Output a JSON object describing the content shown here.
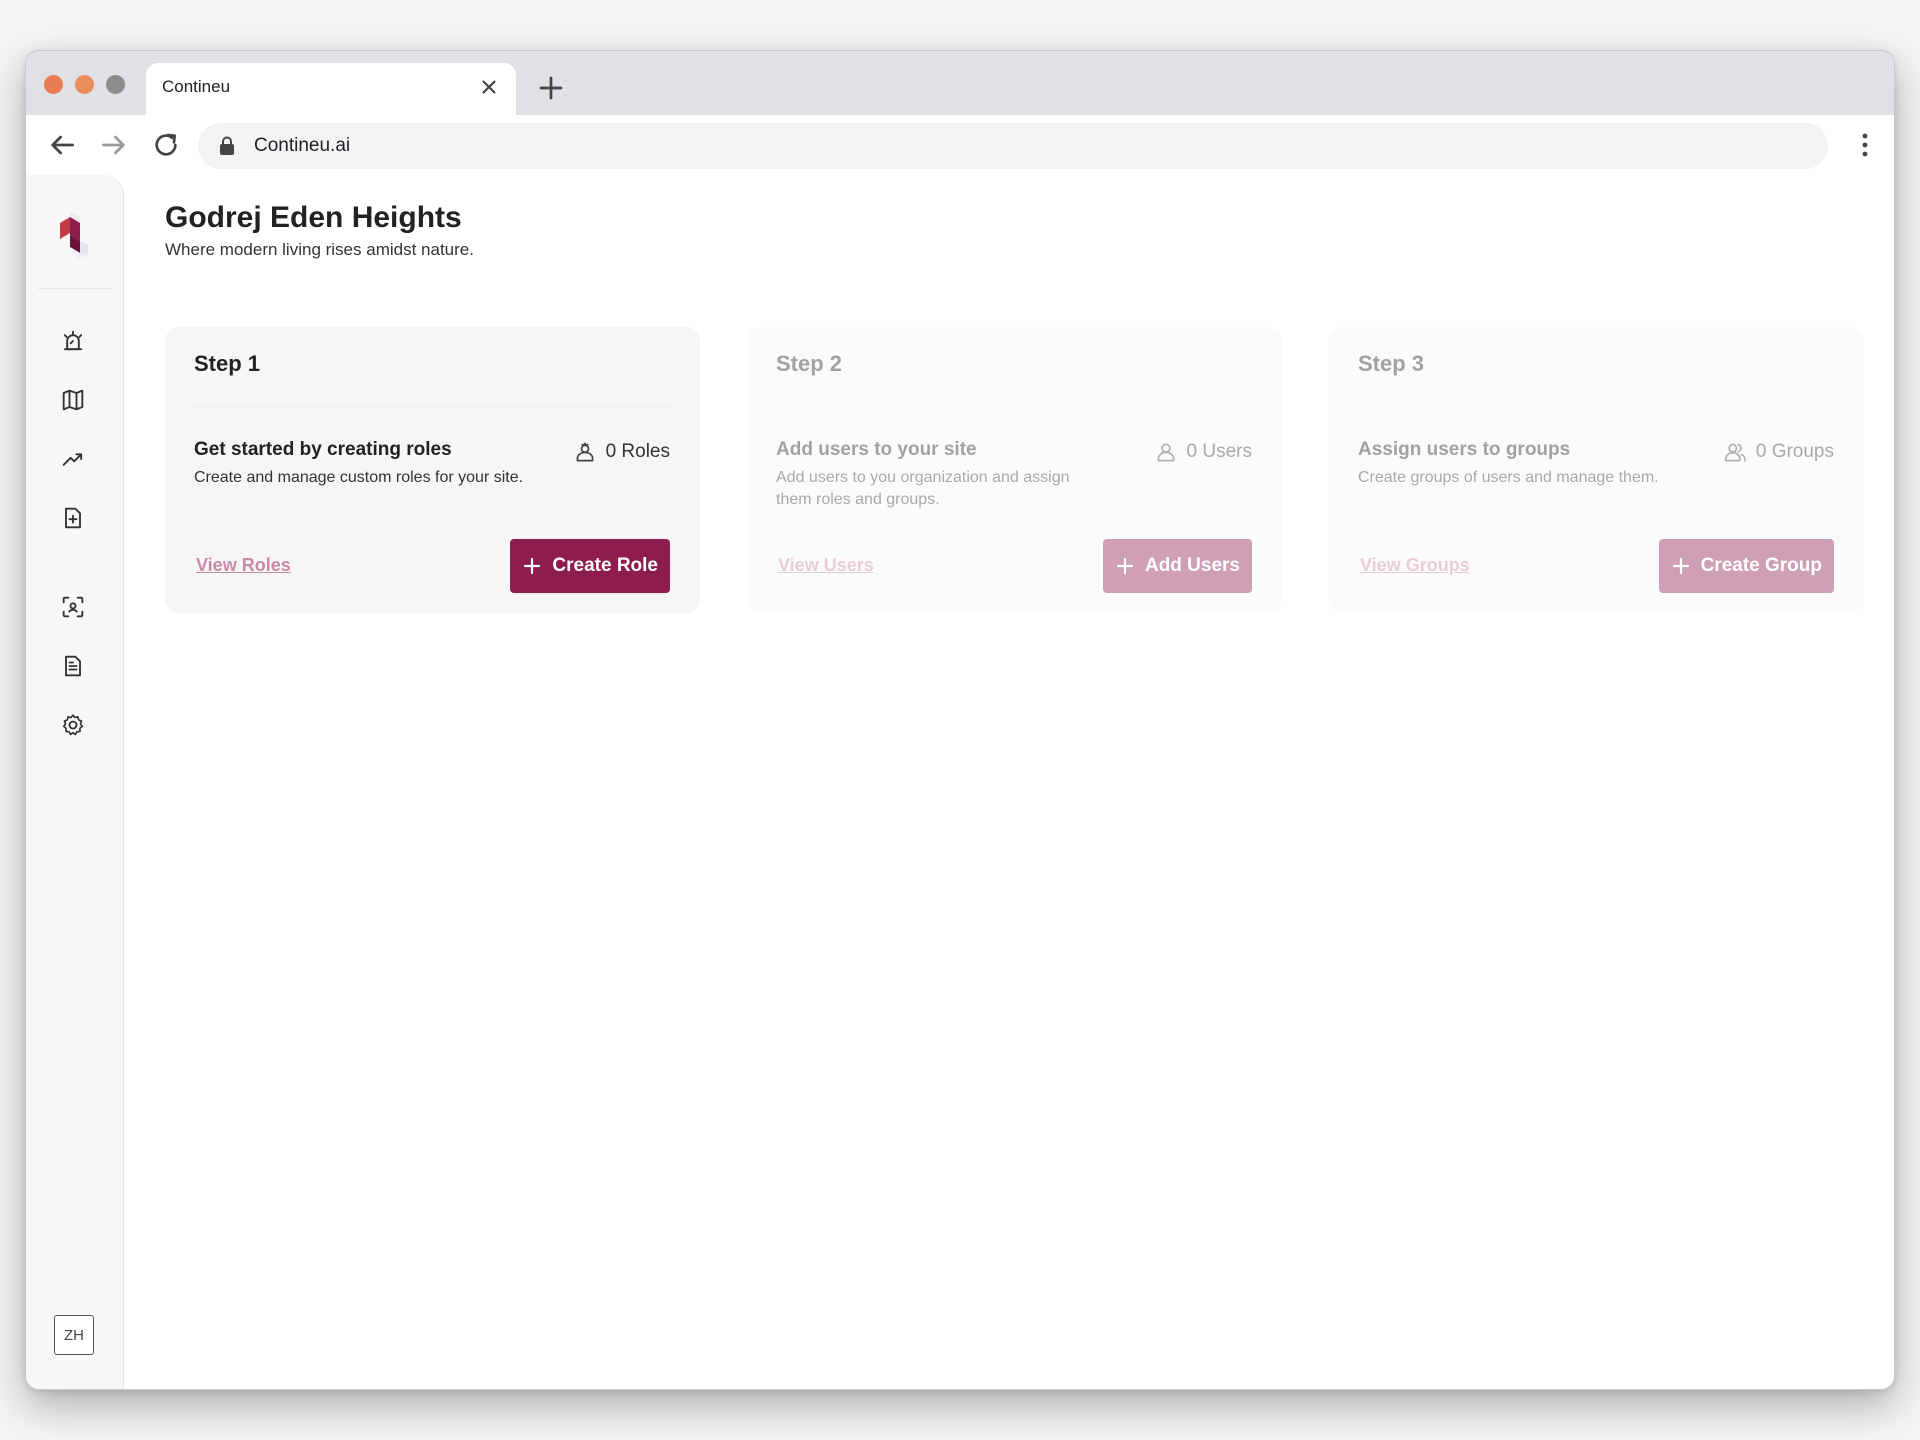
{
  "browser": {
    "tab_title": "Contineu",
    "url": "Contineu.ai"
  },
  "sidebar": {
    "items": [
      {
        "name": "alarm"
      },
      {
        "name": "map"
      },
      {
        "name": "trending-up"
      },
      {
        "name": "file-plus"
      },
      {
        "name": "scan"
      },
      {
        "name": "document"
      },
      {
        "name": "settings"
      }
    ],
    "language": "ZH"
  },
  "page": {
    "title": "Godrej Eden Heights",
    "subtitle": "Where modern living rises amidst nature."
  },
  "steps": [
    {
      "step": "Step 1",
      "heading": "Get started by creating roles",
      "description": "Create and manage custom roles for your site.",
      "count": "0 Roles",
      "link": "View Roles",
      "button": "Create Role"
    },
    {
      "step": "Step 2",
      "heading": "Add users to your site",
      "description": "Add users to you organization and assign them roles and groups.",
      "count": "0 Users",
      "link": "View Users",
      "button": "Add Users"
    },
    {
      "step": "Step 3",
      "heading": "Assign users to groups",
      "description": "Create groups of users and manage them.",
      "count": "0 Groups",
      "link": "View Groups",
      "button": "Create Group"
    }
  ],
  "colors": {
    "accent": "#8e1c4f",
    "link": "#c98aa6"
  }
}
